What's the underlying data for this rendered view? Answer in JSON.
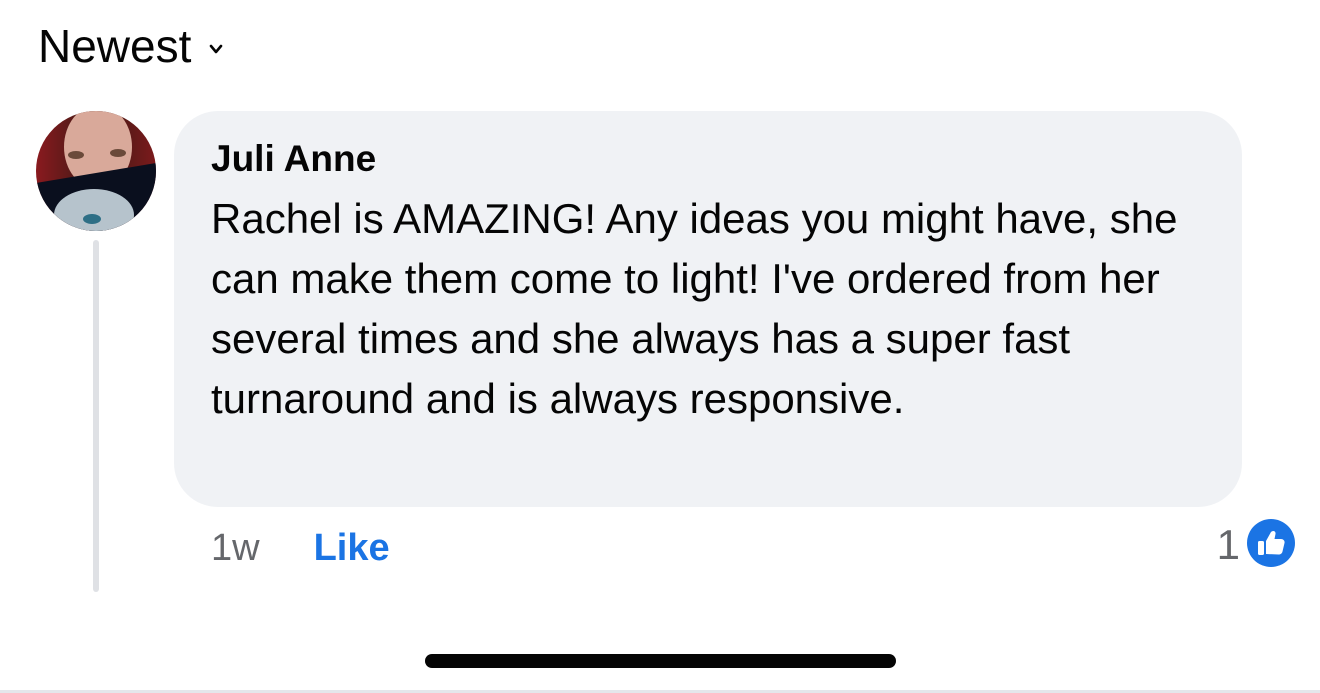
{
  "sort": {
    "label": "Newest",
    "icon": "chevron-down-icon"
  },
  "comment": {
    "author": "Juli Anne",
    "text": "Rachel is AMAZING! Any ideas you might have, she can make them come to light! I've ordered from her several times and she always has a super fast turnaround and is always responsive.",
    "time": "1w",
    "like_label": "Like",
    "reaction_count": "1",
    "reaction_icon": "thumbs-up-icon"
  },
  "colors": {
    "bubble_bg": "#f0f2f5",
    "like_blue": "#1b74e4",
    "meta_gray": "#65676b"
  }
}
